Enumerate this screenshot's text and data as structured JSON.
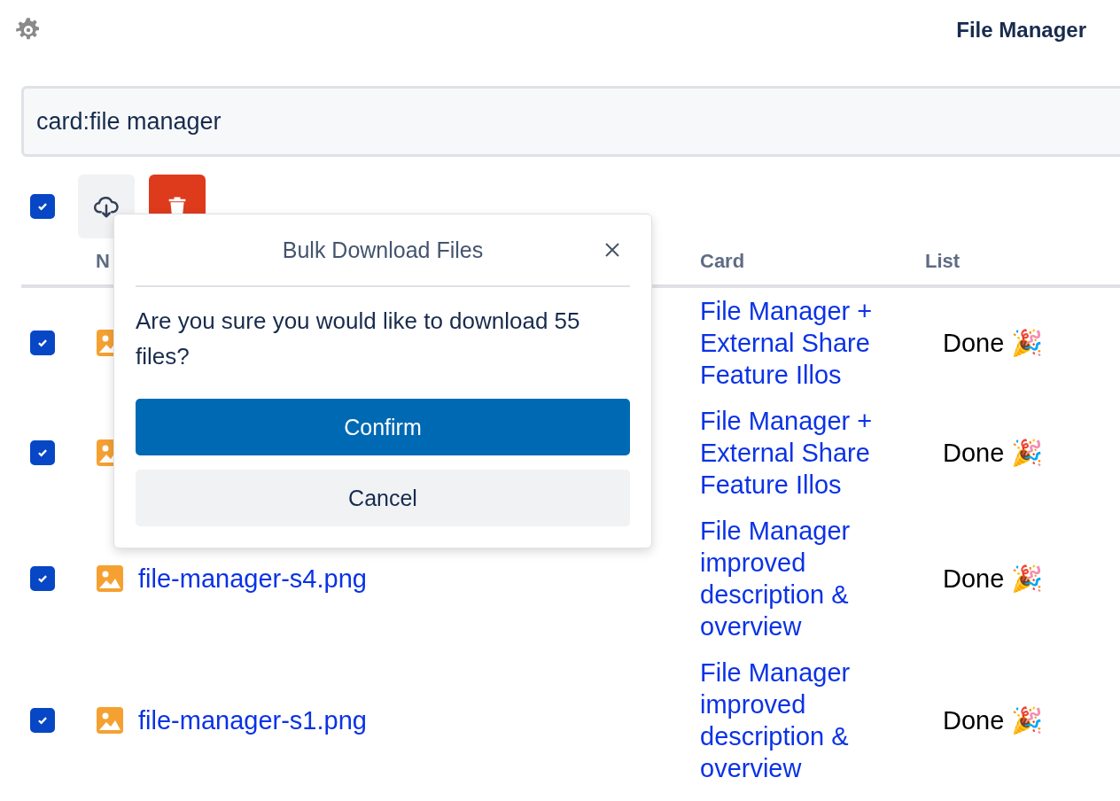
{
  "header": {
    "title": "File Manager"
  },
  "search": {
    "value": "card:file manager"
  },
  "toolbar": {
    "select_all": {
      "checked": true
    }
  },
  "table": {
    "columns": [
      "N",
      "",
      "Card",
      "List"
    ],
    "rows": [
      {
        "checked": true,
        "card": "File Manager + External Share Feature Illos",
        "list": "Done 🎉"
      },
      {
        "checked": true,
        "card": "File Manager + External Share Feature Illos",
        "list": "Done 🎉"
      },
      {
        "checked": true,
        "name": "file-manager-s4.png",
        "card": "File Manager improved description & overview",
        "list": "Done 🎉"
      },
      {
        "checked": true,
        "name": "file-manager-s1.png",
        "card": "File Manager improved description & overview",
        "list": "Done 🎉"
      }
    ]
  },
  "popover": {
    "title": "Bulk Download Files",
    "message": "Are you sure you would like to download 55 files?",
    "buttons": [
      {
        "kind": "primary",
        "label": "Confirm"
      },
      {
        "kind": "secondary",
        "label": "Cancel"
      }
    ]
  }
}
